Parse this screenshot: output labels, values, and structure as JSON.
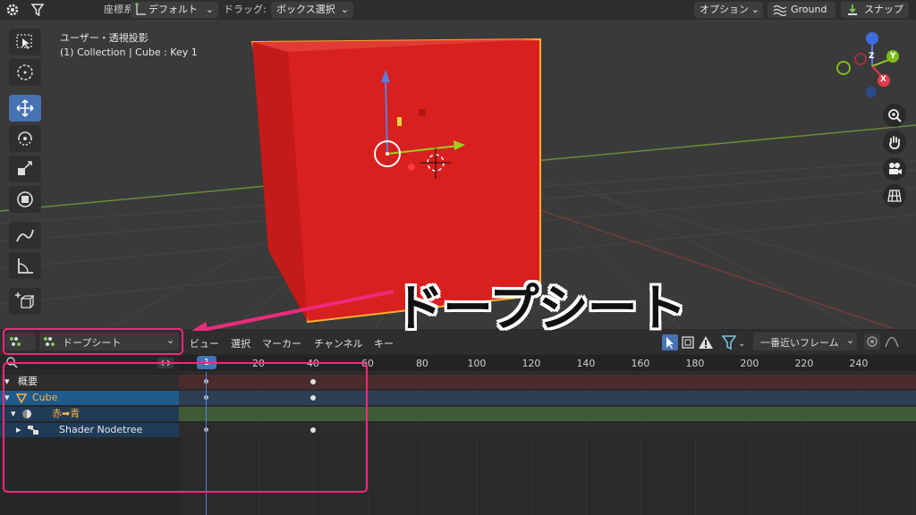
{
  "top_header": {
    "coord_label": "座標系:",
    "coord_value": "デフォルト",
    "drag_label": "ドラッグ:",
    "drag_value": "ボックス選択",
    "options_label": "オプション",
    "ground_label": "Ground",
    "snap_label": "スナップ"
  },
  "viewport": {
    "view_name": "ユーザー・透視投影",
    "object_info": "(1) Collection | Cube : Key 1",
    "gizmo_axes": [
      "Z",
      "Y",
      "X"
    ],
    "cube_color": "#d8201f",
    "selection_outline_color": "#ffae2a",
    "background_color": "#3a3a3a"
  },
  "annotation": {
    "title": "ドープシート",
    "highlight_color": "#f02a79"
  },
  "dopesheet": {
    "editor_type": "ドープシート",
    "menus": [
      "ビュー",
      "選択",
      "マーカー",
      "チャンネル",
      "キー"
    ],
    "snap_mode": "一番近いフレーム",
    "current_frame": "1",
    "ruler_ticks": [
      "20",
      "40",
      "60",
      "80",
      "100",
      "120",
      "140",
      "160",
      "180",
      "200",
      "220",
      "240"
    ],
    "channels": [
      {
        "label": "概要"
      },
      {
        "label": "Cube"
      },
      {
        "label": "赤➡青"
      },
      {
        "label": "Shader Nodetree"
      }
    ],
    "keyframes": [
      1,
      40
    ]
  },
  "icons": [
    "gear-icon",
    "filter-icon",
    "orientation-icon",
    "ground-icon",
    "snap-icon",
    "select-box-icon",
    "cursor-icon",
    "move-icon",
    "rotate-icon",
    "scale-icon",
    "transform-icon",
    "annotate-icon",
    "measure-icon",
    "add-cube-icon",
    "zoom-icon",
    "hand-icon",
    "camera-icon",
    "grid-icon",
    "dopesheet-icon",
    "search-icon",
    "funnel-icon",
    "proportional-icon"
  ]
}
